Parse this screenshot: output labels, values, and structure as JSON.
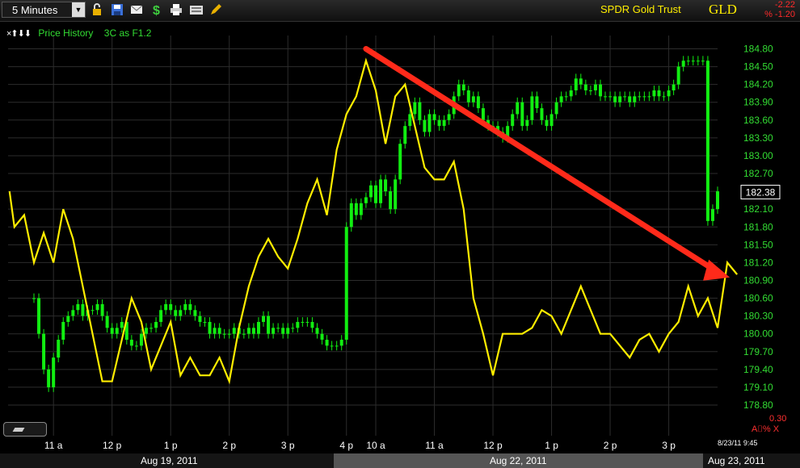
{
  "toolbar": {
    "interval": "5 Minutes",
    "icons": [
      "lock-icon",
      "save-icon",
      "email-icon",
      "dollar-icon",
      "print-icon",
      "keyboard-icon",
      "pencil-icon"
    ]
  },
  "instrument": {
    "name": "SPDR Gold Trust",
    "symbol": "GLD",
    "change_net": "-2.22",
    "change_pct": "% -1.20"
  },
  "legend": {
    "arrows": "×⬆⬇⬇",
    "price_history": "Price History",
    "indicator": "3C as F1.2"
  },
  "colors": {
    "price_up": "#11ee11",
    "indicator": "#ffee00",
    "arrow": "#ff2a1a",
    "axis_text": "#33dd33"
  },
  "indicator_scale_label": "0.30",
  "a_pct_label": "A⌷% X",
  "timestamp": "8/23/11 9:45",
  "dates": [
    "Aug 19, 2011",
    "Aug 22, 2011",
    "Aug 23, 2011"
  ],
  "chart_data": {
    "type": "line",
    "title": "SPDR Gold Trust",
    "y_ticks": [
      184.8,
      184.5,
      184.2,
      183.9,
      183.6,
      183.3,
      183.0,
      182.7,
      182.4,
      182.1,
      181.8,
      181.5,
      181.2,
      180.9,
      180.6,
      180.3,
      180.0,
      179.7,
      179.4,
      179.1,
      178.8
    ],
    "ylim": [
      178.6,
      185.0
    ],
    "last_price": "182.38",
    "x_ticks": [
      "11 a",
      "12 p",
      "1 p",
      "2 p",
      "3 p",
      "4 p",
      "10 a",
      "11 a",
      "12 p",
      "1 p",
      "2 p",
      "3 p"
    ],
    "x_tick_values": [
      4,
      16,
      28,
      40,
      52,
      64,
      70,
      82,
      94,
      106,
      118,
      130
    ],
    "x_range": [
      -5,
      145
    ],
    "price_series": {
      "name": "Price History",
      "close": [
        180.6,
        180.0,
        179.4,
        179.1,
        179.6,
        179.9,
        180.2,
        180.3,
        180.4,
        180.5,
        180.3,
        180.4,
        180.4,
        180.5,
        180.3,
        180.1,
        180.0,
        180.1,
        180.2,
        179.9,
        179.8,
        179.8,
        180.0,
        180.1,
        180.1,
        180.2,
        180.4,
        180.5,
        180.4,
        180.3,
        180.4,
        180.5,
        180.4,
        180.3,
        180.2,
        180.2,
        180.0,
        180.1,
        180.0,
        180.0,
        180.0,
        180.1,
        180.0,
        180.0,
        180.1,
        180.0,
        180.2,
        180.3,
        180.0,
        180.1,
        180.1,
        180.0,
        180.1,
        180.1,
        180.2,
        180.2,
        180.2,
        180.1,
        180.0,
        179.9,
        179.8,
        179.8,
        179.8,
        179.9,
        181.8,
        182.2,
        182.0,
        182.2,
        182.3,
        182.5,
        182.2,
        182.6,
        182.4,
        182.1,
        182.6,
        183.2,
        183.5,
        183.7,
        183.9,
        183.6,
        183.4,
        183.7,
        183.6,
        183.5,
        183.6,
        183.7,
        184.0,
        184.2,
        184.1,
        183.9,
        184.0,
        183.8,
        183.6,
        183.5,
        183.5,
        183.4,
        183.3,
        183.5,
        183.7,
        183.9,
        183.5,
        183.6,
        184.0,
        183.8,
        183.6,
        183.5,
        183.7,
        183.9,
        184.0,
        184.0,
        184.1,
        184.3,
        184.2,
        184.1,
        184.1,
        184.2,
        184.0,
        184.0,
        184.0,
        183.9,
        184.0,
        184.0,
        183.9,
        184.0,
        184.0,
        184.0,
        184.0,
        184.1,
        184.0,
        184.0,
        184.1,
        184.2,
        184.5,
        184.6,
        184.6,
        184.6,
        184.6,
        184.6,
        181.9,
        182.1,
        182.4
      ],
      "last_gap_index": 140
    },
    "indicator_series": {
      "name": "3C as F1.2",
      "x": [
        -5,
        -4,
        -2,
        0,
        2,
        4,
        6,
        8,
        10,
        12,
        14,
        16,
        18,
        20,
        22,
        24,
        26,
        28,
        30,
        32,
        34,
        36,
        38,
        40,
        42,
        44,
        46,
        48,
        50,
        52,
        54,
        56,
        58,
        60,
        62,
        64,
        66,
        68,
        70,
        72,
        74,
        76,
        78,
        80,
        82,
        84,
        86,
        88,
        90,
        92,
        94,
        96,
        98,
        100,
        102,
        104,
        106,
        108,
        110,
        112,
        114,
        116,
        118,
        120,
        122,
        124,
        126,
        128,
        130,
        132,
        134,
        136,
        138,
        140,
        142,
        144
      ],
      "y": [
        182.4,
        181.8,
        182.0,
        181.2,
        181.7,
        181.2,
        182.1,
        181.6,
        180.8,
        180.0,
        179.2,
        179.2,
        179.9,
        180.6,
        180.2,
        179.4,
        179.8,
        180.2,
        179.3,
        179.6,
        179.3,
        179.3,
        179.6,
        179.2,
        180.1,
        180.8,
        181.3,
        181.6,
        181.3,
        181.1,
        181.6,
        182.2,
        182.6,
        182.0,
        183.1,
        183.7,
        184.0,
        184.6,
        184.1,
        183.2,
        184.0,
        184.2,
        183.5,
        182.8,
        182.6,
        182.6,
        182.9,
        182.1,
        180.6,
        180.0,
        179.3,
        180.0,
        180.0,
        180.0,
        180.1,
        180.4,
        180.3,
        180.0,
        180.4,
        180.8,
        180.4,
        180.0,
        180.0,
        179.8,
        179.6,
        179.9,
        180.0,
        179.7,
        180.0,
        180.2,
        180.8,
        180.3,
        180.6,
        180.1,
        181.2,
        181.0
      ],
      "note": ""
    }
  }
}
